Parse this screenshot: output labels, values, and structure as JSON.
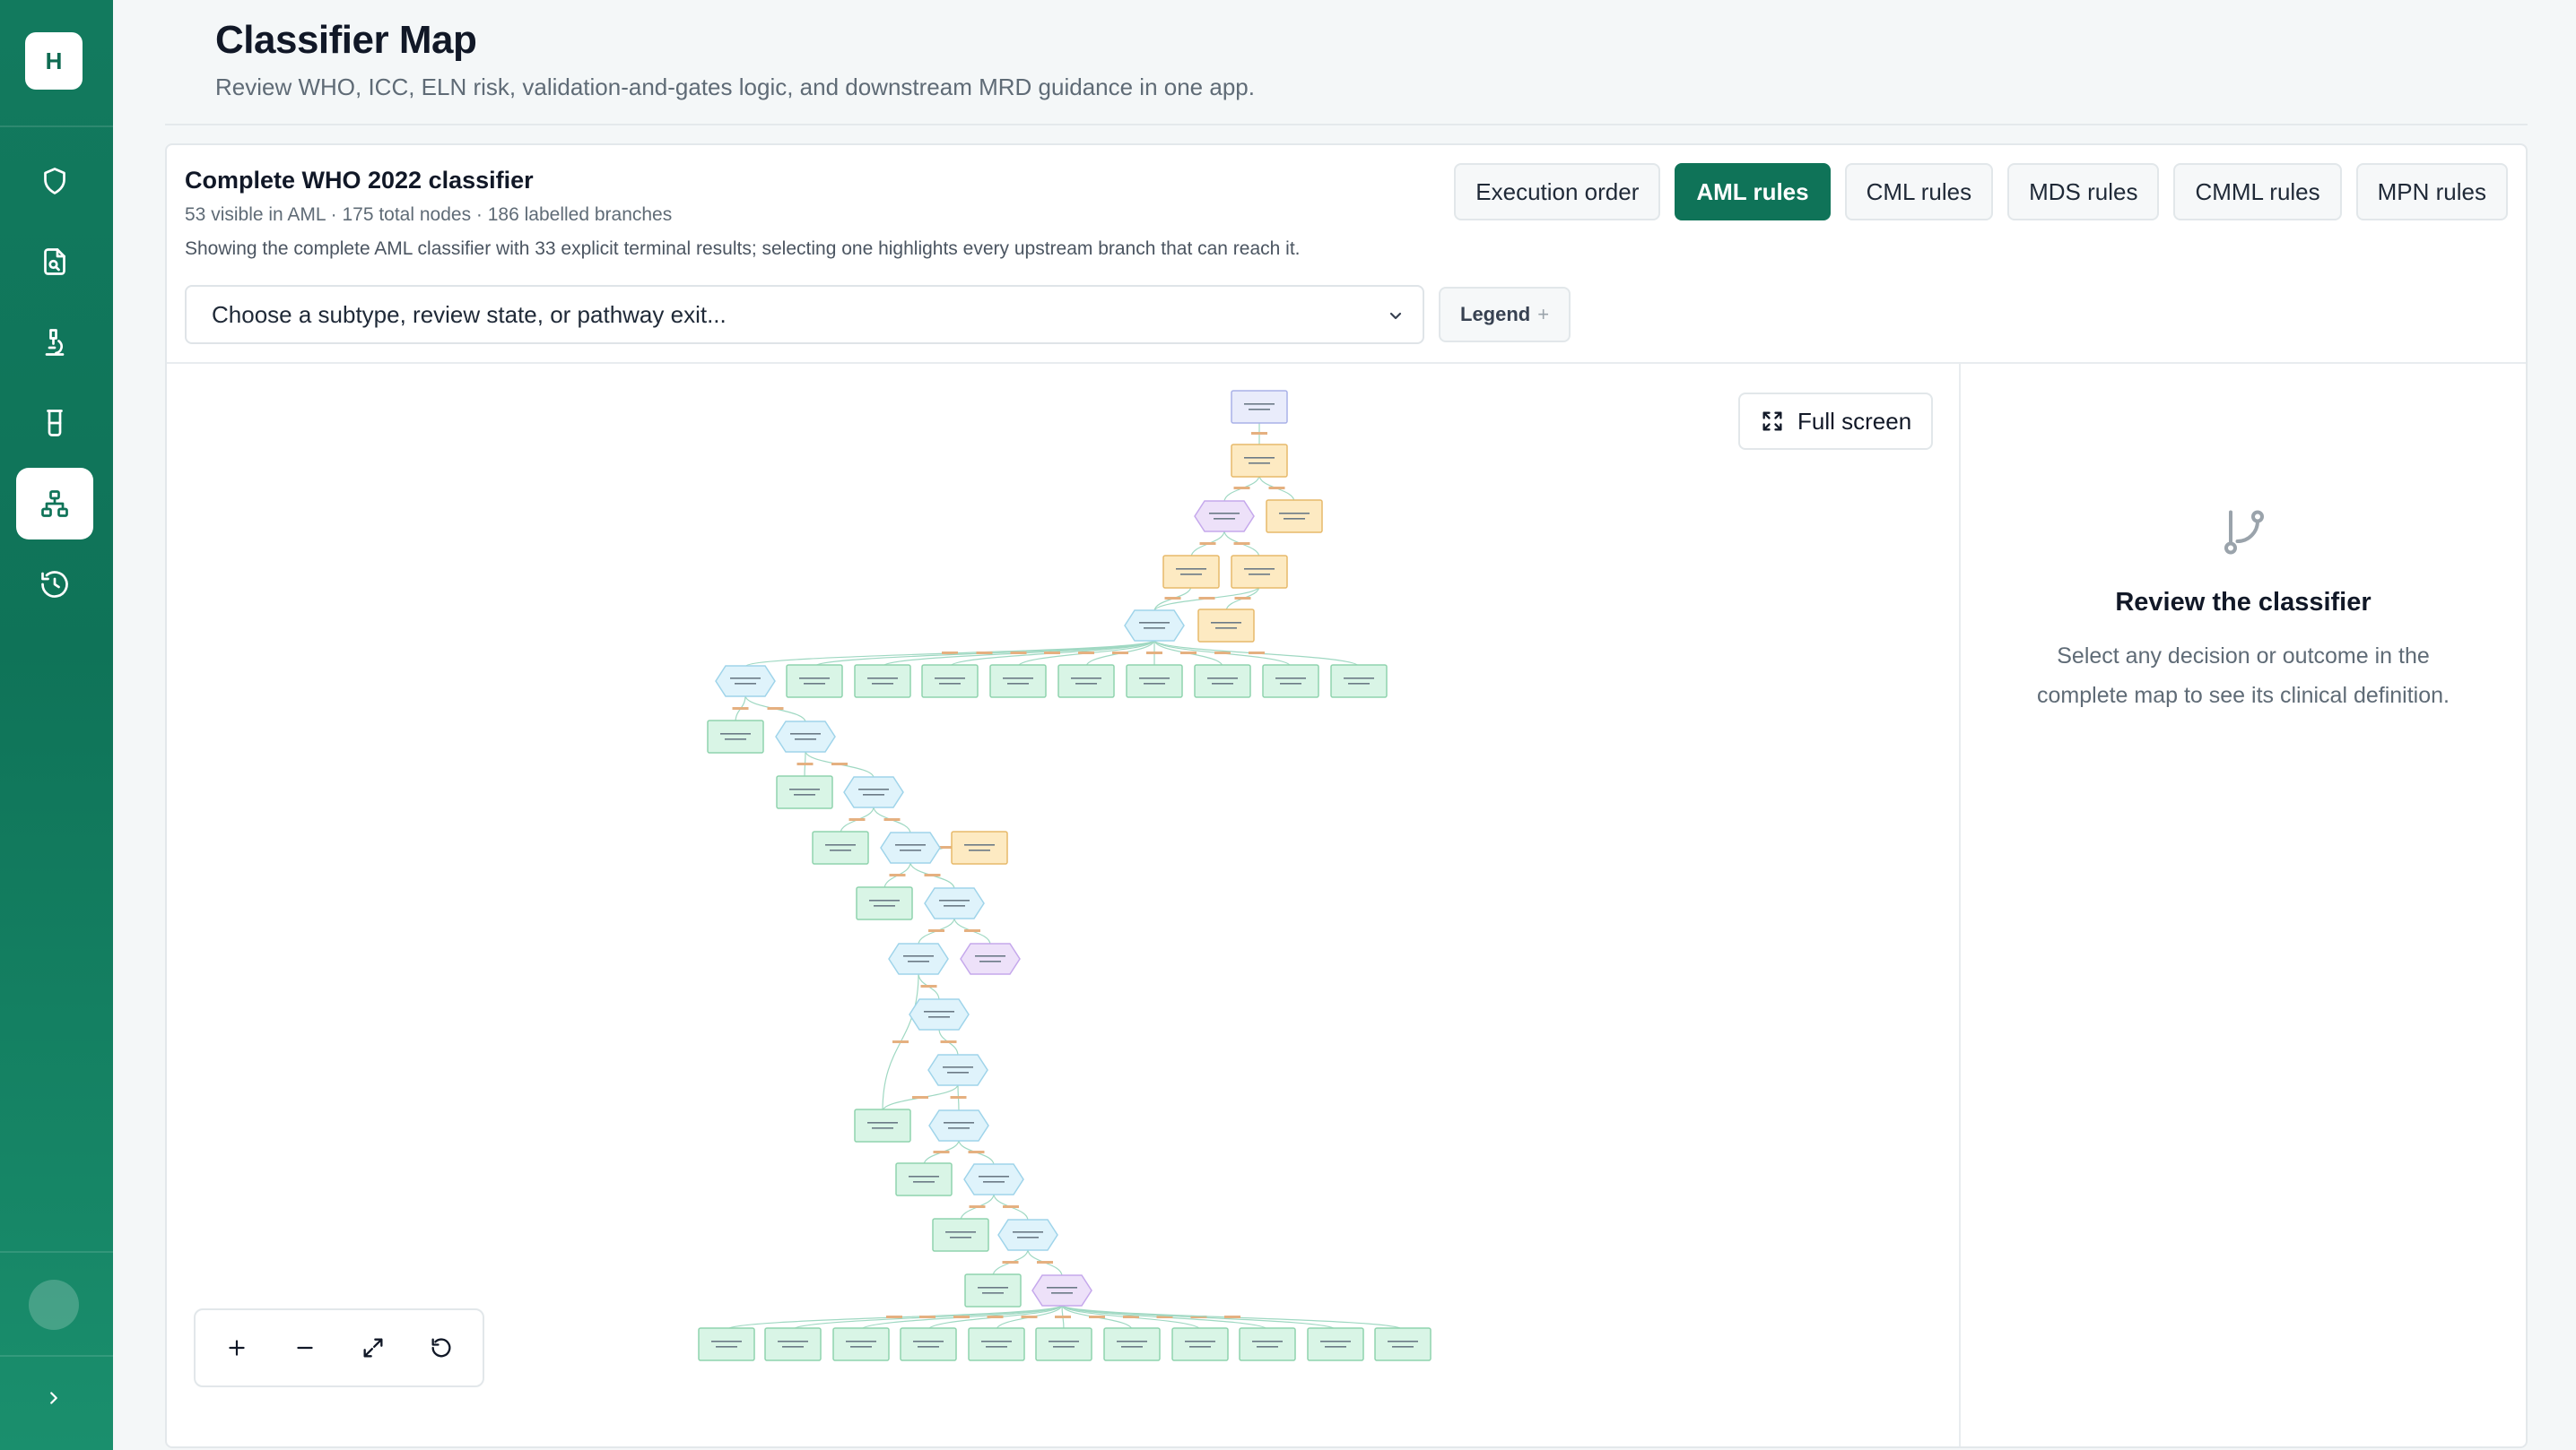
{
  "brand": {
    "initial": "H"
  },
  "nav": {
    "items": [
      {
        "name": "shield-icon"
      },
      {
        "name": "document-search-icon"
      },
      {
        "name": "microscope-icon"
      },
      {
        "name": "test-tube-icon"
      },
      {
        "name": "hierarchy-icon",
        "active": true
      },
      {
        "name": "history-icon"
      }
    ]
  },
  "header": {
    "title": "Classifier Map",
    "subtitle": "Review WHO, ICC, ELN risk, validation-and-gates logic, and downstream MRD guidance in one app."
  },
  "classifier": {
    "title": "Complete WHO 2022 classifier",
    "meta": "53 visible in AML · 175 total nodes · 186 labelled branches",
    "description": "Showing the complete AML classifier with 33 explicit terminal results; selecting one highlights every upstream branch that can reach it."
  },
  "tabs": [
    {
      "label": "Execution order",
      "active": false
    },
    {
      "label": "AML rules",
      "active": true
    },
    {
      "label": "CML rules",
      "active": false
    },
    {
      "label": "MDS rules",
      "active": false
    },
    {
      "label": "CMML rules",
      "active": false
    },
    {
      "label": "MPN rules",
      "active": false
    }
  ],
  "search": {
    "placeholder": "Choose a subtype, review state, or pathway exit..."
  },
  "legend": {
    "label": "Legend",
    "icon": "plus-icon"
  },
  "canvas": {
    "fullscreen_label": "Full screen"
  },
  "panel": {
    "title": "Review the classifier",
    "text": "Select any decision or outcome in the complete map to see its clinical definition."
  },
  "colors": {
    "brand": "#0f7358",
    "decision": "#dff3fb",
    "outcome": "#d9f5e6",
    "warning": "#fdeac2",
    "start": "#e9ecfb",
    "gate": "#ede1f9"
  }
}
